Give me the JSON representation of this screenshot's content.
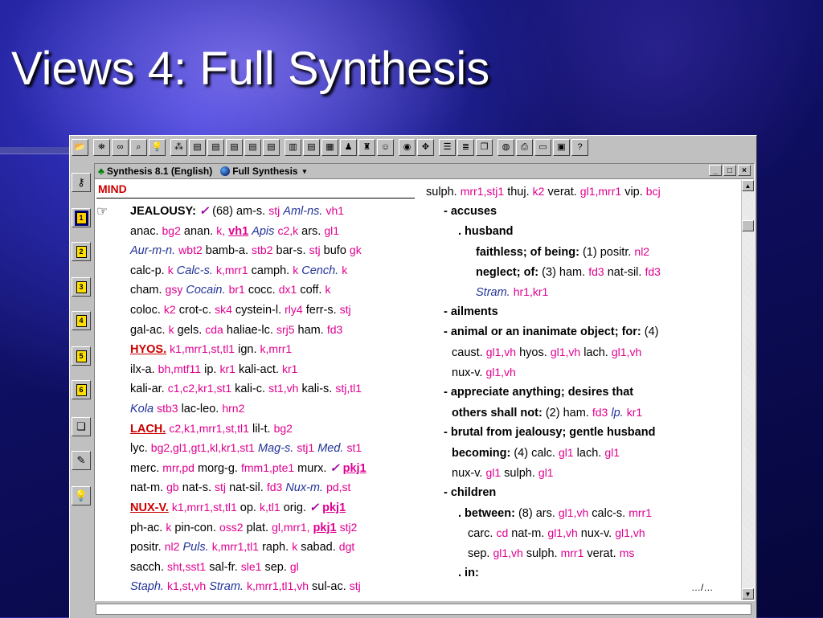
{
  "slide": {
    "title": "Views 4: Full Synthesis"
  },
  "window": {
    "title": "Synthesis 8.1 (English)",
    "view": "Full Synthesis",
    "controls": {
      "minimize": "_",
      "maximize": "□",
      "close": "×"
    }
  },
  "toolbar_icons": [
    "open-folder-icon",
    "binoculars-icon",
    "glasses-icon",
    "magnifier-icon",
    "lightbulb-icon",
    "graph-icon",
    "clipboard-1-icon",
    "clipboard-2-icon",
    "clipboard-3-icon",
    "clipboard-4-icon",
    "clipboard-5-icon",
    "bar-chart-icon",
    "remedy-book-icon",
    "grid-icon",
    "people-icon",
    "people-list-icon",
    "smiley-icon",
    "cd-icon",
    "network-icon",
    "notes-icon",
    "list-icon",
    "copy-icon",
    "globe-icon",
    "print-icon",
    "card-icon",
    "photo-icon",
    "help-icon"
  ],
  "sidebar_icons": [
    "key-icon",
    "clipboard-1-icon",
    "clipboard-2-icon",
    "clipboard-3-icon",
    "clipboard-4-icon",
    "clipboard-5-icon",
    "clipboard-6-icon",
    "copy-doc-icon",
    "report-icon",
    "lightbulb-icon"
  ],
  "sidebar_numbers": [
    "1",
    "2",
    "3",
    "4",
    "5",
    "6"
  ],
  "left": {
    "chapter": "MIND",
    "lines": [
      [
        [
          "b",
          "JEALOUSY:"
        ],
        [
          "chk",
          "✓"
        ],
        [
          "t",
          "(68) am-s."
        ],
        [
          "m",
          "stj"
        ],
        [
          "i",
          "Aml-ns."
        ],
        [
          "m",
          "vh1"
        ]
      ],
      [
        [
          "t",
          "anac."
        ],
        [
          "m",
          "bg2"
        ],
        [
          "t",
          "anan."
        ],
        [
          "m",
          "k,"
        ],
        [
          "mb",
          "vh1"
        ],
        [
          "i",
          "Apis"
        ],
        [
          "m",
          "c2,k"
        ],
        [
          "t",
          "ars."
        ],
        [
          "m",
          "gl1"
        ]
      ],
      [
        [
          "i",
          "Aur-m-n."
        ],
        [
          "m",
          "wbt2"
        ],
        [
          "t",
          "bamb-a."
        ],
        [
          "m",
          "stb2"
        ],
        [
          "t",
          "bar-s."
        ],
        [
          "m",
          "stj"
        ],
        [
          "t",
          "bufo"
        ],
        [
          "m",
          "gk"
        ]
      ],
      [
        [
          "t",
          "calc-p."
        ],
        [
          "m",
          "k"
        ],
        [
          "i",
          "Calc-s."
        ],
        [
          "m",
          "k,mrr1"
        ],
        [
          "t",
          "camph."
        ],
        [
          "m",
          "k"
        ],
        [
          "i",
          "Cench."
        ],
        [
          "m",
          "k"
        ]
      ],
      [
        [
          "t",
          "cham."
        ],
        [
          "m",
          "gsy"
        ],
        [
          "i",
          "Cocain."
        ],
        [
          "m",
          "br1"
        ],
        [
          "t",
          "cocc."
        ],
        [
          "m",
          "dx1"
        ],
        [
          "t",
          "coff."
        ],
        [
          "m",
          "k"
        ]
      ],
      [
        [
          "t",
          "coloc."
        ],
        [
          "m",
          "k2"
        ],
        [
          "t",
          "crot-c."
        ],
        [
          "m",
          "sk4"
        ],
        [
          "t",
          "cystein-l."
        ],
        [
          "m",
          "rly4"
        ],
        [
          "t",
          "ferr-s."
        ],
        [
          "m",
          "stj"
        ]
      ],
      [
        [
          "t",
          "gal-ac."
        ],
        [
          "m",
          "k"
        ],
        [
          "t",
          "gels."
        ],
        [
          "m",
          "cda"
        ],
        [
          "t",
          "haliae-lc."
        ],
        [
          "m",
          "srj5"
        ],
        [
          "t",
          "ham."
        ],
        [
          "m",
          "fd3"
        ]
      ],
      [
        [
          "r",
          "HYOS."
        ],
        [
          "m",
          "k1,mrr1,st,tl1"
        ],
        [
          "t",
          "ign."
        ],
        [
          "m",
          "k,mrr1"
        ]
      ],
      [
        [
          "t",
          "ilx-a."
        ],
        [
          "m",
          "bh,mtf11"
        ],
        [
          "t",
          "ip."
        ],
        [
          "m",
          "kr1"
        ],
        [
          "t",
          "kali-act."
        ],
        [
          "m",
          "kr1"
        ]
      ],
      [
        [
          "t",
          "kali-ar."
        ],
        [
          "m",
          "c1,c2,kr1,st1"
        ],
        [
          "t",
          "kali-c."
        ],
        [
          "m",
          "st1,vh"
        ],
        [
          "t",
          "kali-s."
        ],
        [
          "m",
          "stj,tl1"
        ]
      ],
      [
        [
          "i",
          "Kola"
        ],
        [
          "m",
          "stb3"
        ],
        [
          "t",
          "lac-leo."
        ],
        [
          "m",
          "hrn2"
        ]
      ],
      [
        [
          "r",
          "LACH."
        ],
        [
          "m",
          "c2,k1,mrr1,st,tl1"
        ],
        [
          "t",
          "lil-t."
        ],
        [
          "m",
          "bg2"
        ]
      ],
      [
        [
          "t",
          "lyc."
        ],
        [
          "m",
          "bg2,gl1,gt1,kl,kr1,st1"
        ],
        [
          "i",
          "Mag-s."
        ],
        [
          "m",
          "stj1"
        ],
        [
          "i",
          "Med."
        ],
        [
          "m",
          "st1"
        ]
      ],
      [
        [
          "t",
          "merc."
        ],
        [
          "m",
          "mrr,pd"
        ],
        [
          "t",
          "morg-g."
        ],
        [
          "m",
          "fmm1,pte1"
        ],
        [
          "t",
          "murx."
        ],
        [
          "chk",
          "✓"
        ],
        [
          "mb",
          "pkj1"
        ]
      ],
      [
        [
          "t",
          "nat-m."
        ],
        [
          "m",
          "gb"
        ],
        [
          "t",
          "nat-s."
        ],
        [
          "m",
          "stj"
        ],
        [
          "t",
          "nat-sil."
        ],
        [
          "m",
          "fd3"
        ],
        [
          "i",
          "Nux-m."
        ],
        [
          "m",
          "pd,st"
        ]
      ],
      [
        [
          "r",
          "NUX-V."
        ],
        [
          "m",
          "k1,mrr1,st,tl1"
        ],
        [
          "t",
          "op."
        ],
        [
          "m",
          "k,tl1"
        ],
        [
          "t",
          "orig."
        ],
        [
          "chk",
          "✓"
        ],
        [
          "mb",
          "pkj1"
        ]
      ],
      [
        [
          "t",
          "ph-ac."
        ],
        [
          "m",
          "k"
        ],
        [
          "t",
          "pin-con."
        ],
        [
          "m",
          "oss2"
        ],
        [
          "t",
          "plat."
        ],
        [
          "m",
          "gl,mrr1,"
        ],
        [
          "mb",
          "pkj1"
        ],
        [
          "m",
          "stj2"
        ]
      ],
      [
        [
          "t",
          "positr."
        ],
        [
          "m",
          "nl2"
        ],
        [
          "i",
          "Puls."
        ],
        [
          "m",
          "k,mrr1,tl1"
        ],
        [
          "t",
          "raph."
        ],
        [
          "m",
          "k"
        ],
        [
          "t",
          "sabad."
        ],
        [
          "m",
          "dgt"
        ]
      ],
      [
        [
          "t",
          "sacch."
        ],
        [
          "m",
          "sht,sst1"
        ],
        [
          "t",
          "sal-fr."
        ],
        [
          "m",
          "sle1"
        ],
        [
          "t",
          "sep."
        ],
        [
          "m",
          "gl"
        ]
      ],
      [
        [
          "i",
          "Staph."
        ],
        [
          "m",
          "k1,st,vh"
        ],
        [
          "i",
          "Stram."
        ],
        [
          "m",
          "k,mrr1,tl1,vh"
        ],
        [
          "t",
          "sul-ac."
        ],
        [
          "m",
          "stj"
        ]
      ]
    ]
  },
  "right": {
    "lines": [
      {
        "indent": 0,
        "parts": [
          [
            "t",
            "sulph."
          ],
          [
            "m",
            "mrr1,stj1"
          ],
          [
            "t",
            "thuj."
          ],
          [
            "m",
            "k2"
          ],
          [
            "t",
            "verat."
          ],
          [
            "m",
            "gl1,mrr1"
          ],
          [
            "t",
            "vip."
          ],
          [
            "m",
            "bcj"
          ]
        ]
      },
      {
        "indent": 22,
        "parts": [
          [
            "b",
            "- accuses"
          ]
        ]
      },
      {
        "indent": 40,
        "parts": [
          [
            "b",
            ". husband"
          ]
        ]
      },
      {
        "indent": 62,
        "parts": [
          [
            "b",
            "faithless; of being:"
          ],
          [
            "t",
            "(1) positr."
          ],
          [
            "m",
            "nl2"
          ]
        ]
      },
      {
        "indent": 62,
        "parts": [
          [
            "b",
            "neglect; of:"
          ],
          [
            "t",
            "(3) ham."
          ],
          [
            "m",
            "fd3"
          ],
          [
            "t",
            "nat-sil."
          ],
          [
            "m",
            "fd3"
          ]
        ]
      },
      {
        "indent": 62,
        "parts": [
          [
            "i",
            "Stram."
          ],
          [
            "m",
            "hr1,kr1"
          ]
        ]
      },
      {
        "indent": 22,
        "parts": [
          [
            "b",
            "- ailments"
          ]
        ]
      },
      {
        "indent": 22,
        "parts": [
          [
            "b",
            "- animal or an inanimate object; for:"
          ],
          [
            "t",
            "(4)"
          ]
        ]
      },
      {
        "indent": 32,
        "parts": [
          [
            "t",
            "caust."
          ],
          [
            "m",
            "gl1,vh"
          ],
          [
            "t",
            "hyos."
          ],
          [
            "m",
            "gl1,vh"
          ],
          [
            "t",
            "lach."
          ],
          [
            "m",
            "gl1,vh"
          ]
        ]
      },
      {
        "indent": 32,
        "parts": [
          [
            "t",
            "nux-v."
          ],
          [
            "m",
            "gl1,vh"
          ]
        ]
      },
      {
        "indent": 22,
        "parts": [
          [
            "b",
            "- appreciate anything; desires that"
          ]
        ]
      },
      {
        "indent": 32,
        "parts": [
          [
            "b",
            "others shall not:"
          ],
          [
            "t",
            "(2) ham."
          ],
          [
            "m",
            "fd3"
          ],
          [
            "i",
            "lp."
          ],
          [
            "m",
            "kr1"
          ]
        ]
      },
      {
        "indent": 22,
        "parts": [
          [
            "b",
            "- brutal from jealousy; gentle husband"
          ]
        ]
      },
      {
        "indent": 32,
        "parts": [
          [
            "b",
            "becoming:"
          ],
          [
            "t",
            "(4) calc."
          ],
          [
            "m",
            "gl1"
          ],
          [
            "t",
            "lach."
          ],
          [
            "m",
            "gl1"
          ]
        ]
      },
      {
        "indent": 32,
        "parts": [
          [
            "t",
            "nux-v."
          ],
          [
            "m",
            "gl1"
          ],
          [
            "t",
            "sulph."
          ],
          [
            "m",
            "gl1"
          ]
        ]
      },
      {
        "indent": 22,
        "parts": [
          [
            "b",
            "- children"
          ]
        ]
      },
      {
        "indent": 40,
        "parts": [
          [
            "b",
            ". between:"
          ],
          [
            "t",
            "(8) ars."
          ],
          [
            "m",
            "gl1,vh"
          ],
          [
            "t",
            "calc-s."
          ],
          [
            "m",
            "mrr1"
          ]
        ]
      },
      {
        "indent": 52,
        "parts": [
          [
            "t",
            "carc."
          ],
          [
            "m",
            "cd"
          ],
          [
            "t",
            "nat-m."
          ],
          [
            "m",
            "gl1,vh"
          ],
          [
            "t",
            "nux-v."
          ],
          [
            "m",
            "gl1,vh"
          ]
        ]
      },
      {
        "indent": 52,
        "parts": [
          [
            "t",
            "sep."
          ],
          [
            "m",
            "gl1,vh"
          ],
          [
            "t",
            "sulph."
          ],
          [
            "m",
            "mrr1"
          ],
          [
            "t",
            "verat."
          ],
          [
            "m",
            "ms"
          ]
        ]
      },
      {
        "indent": 40,
        "parts": [
          [
            "b",
            ". in:"
          ]
        ]
      }
    ],
    "more": "…/…"
  }
}
